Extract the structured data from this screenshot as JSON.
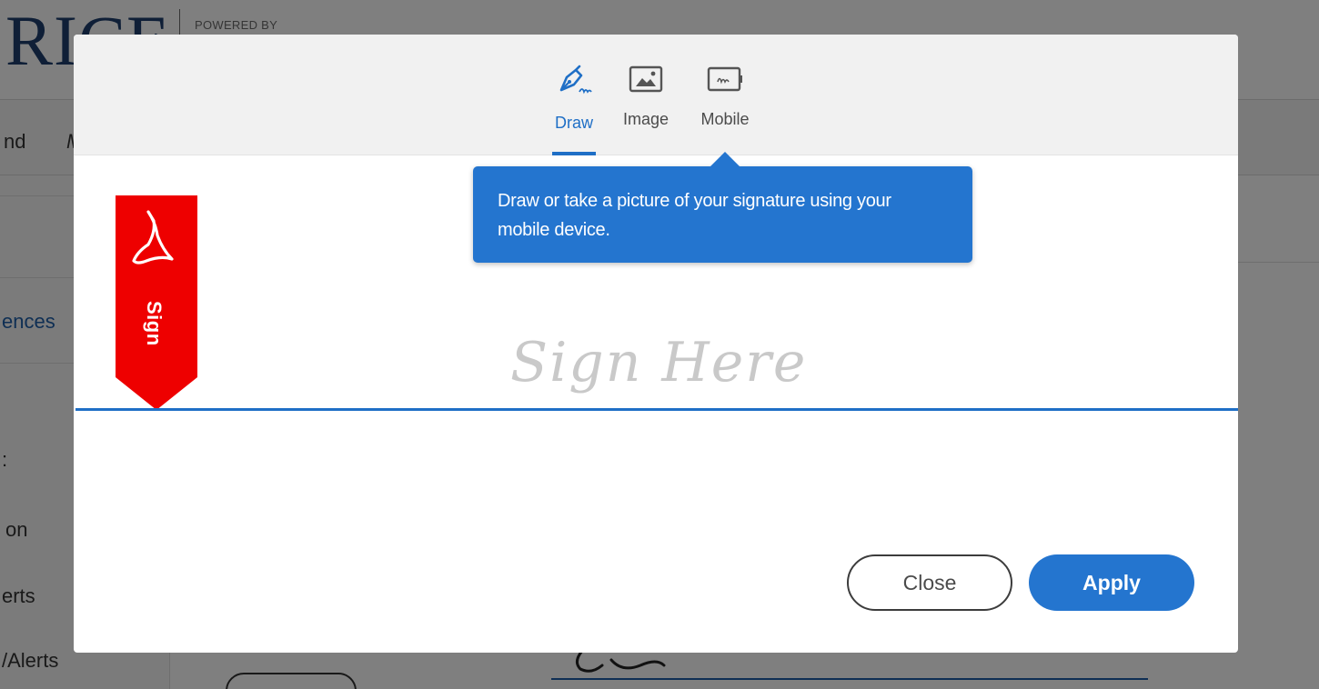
{
  "background": {
    "logo_text": "RICE",
    "powered_by": "POWERED BY",
    "nav_items": [
      "nd",
      "M"
    ],
    "sidebar_items": [
      "ences",
      ":",
      "on",
      "erts",
      "/Alerts"
    ]
  },
  "modal": {
    "tabs": [
      {
        "label": "Draw",
        "icon": "pen-signature-icon",
        "active": true
      },
      {
        "label": "Image",
        "icon": "image-icon",
        "active": false
      },
      {
        "label": "Mobile",
        "icon": "mobile-device-icon",
        "active": false
      }
    ],
    "tooltip_text": "Draw or take a picture of your signature using your mobile device.",
    "sign_flag_label": "Sign",
    "sign_placeholder": "Sign Here",
    "buttons": {
      "close_label": "Close",
      "apply_label": "Apply"
    }
  },
  "colors": {
    "accent": "#2475cf",
    "flag_red": "#ee0000",
    "baseline": "#1f6fc6"
  }
}
